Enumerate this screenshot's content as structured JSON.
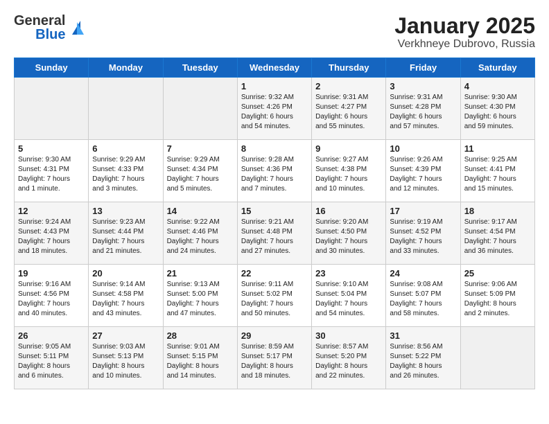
{
  "header": {
    "logo_general": "General",
    "logo_blue": "Blue",
    "title": "January 2025",
    "subtitle": "Verkhneye Dubrovo, Russia"
  },
  "days_of_week": [
    "Sunday",
    "Monday",
    "Tuesday",
    "Wednesday",
    "Thursday",
    "Friday",
    "Saturday"
  ],
  "weeks": [
    [
      {
        "day": "",
        "info": ""
      },
      {
        "day": "",
        "info": ""
      },
      {
        "day": "",
        "info": ""
      },
      {
        "day": "1",
        "info": "Sunrise: 9:32 AM\nSunset: 4:26 PM\nDaylight: 6 hours\nand 54 minutes."
      },
      {
        "day": "2",
        "info": "Sunrise: 9:31 AM\nSunset: 4:27 PM\nDaylight: 6 hours\nand 55 minutes."
      },
      {
        "day": "3",
        "info": "Sunrise: 9:31 AM\nSunset: 4:28 PM\nDaylight: 6 hours\nand 57 minutes."
      },
      {
        "day": "4",
        "info": "Sunrise: 9:30 AM\nSunset: 4:30 PM\nDaylight: 6 hours\nand 59 minutes."
      }
    ],
    [
      {
        "day": "5",
        "info": "Sunrise: 9:30 AM\nSunset: 4:31 PM\nDaylight: 7 hours\nand 1 minute."
      },
      {
        "day": "6",
        "info": "Sunrise: 9:29 AM\nSunset: 4:33 PM\nDaylight: 7 hours\nand 3 minutes."
      },
      {
        "day": "7",
        "info": "Sunrise: 9:29 AM\nSunset: 4:34 PM\nDaylight: 7 hours\nand 5 minutes."
      },
      {
        "day": "8",
        "info": "Sunrise: 9:28 AM\nSunset: 4:36 PM\nDaylight: 7 hours\nand 7 minutes."
      },
      {
        "day": "9",
        "info": "Sunrise: 9:27 AM\nSunset: 4:38 PM\nDaylight: 7 hours\nand 10 minutes."
      },
      {
        "day": "10",
        "info": "Sunrise: 9:26 AM\nSunset: 4:39 PM\nDaylight: 7 hours\nand 12 minutes."
      },
      {
        "day": "11",
        "info": "Sunrise: 9:25 AM\nSunset: 4:41 PM\nDaylight: 7 hours\nand 15 minutes."
      }
    ],
    [
      {
        "day": "12",
        "info": "Sunrise: 9:24 AM\nSunset: 4:43 PM\nDaylight: 7 hours\nand 18 minutes."
      },
      {
        "day": "13",
        "info": "Sunrise: 9:23 AM\nSunset: 4:44 PM\nDaylight: 7 hours\nand 21 minutes."
      },
      {
        "day": "14",
        "info": "Sunrise: 9:22 AM\nSunset: 4:46 PM\nDaylight: 7 hours\nand 24 minutes."
      },
      {
        "day": "15",
        "info": "Sunrise: 9:21 AM\nSunset: 4:48 PM\nDaylight: 7 hours\nand 27 minutes."
      },
      {
        "day": "16",
        "info": "Sunrise: 9:20 AM\nSunset: 4:50 PM\nDaylight: 7 hours\nand 30 minutes."
      },
      {
        "day": "17",
        "info": "Sunrise: 9:19 AM\nSunset: 4:52 PM\nDaylight: 7 hours\nand 33 minutes."
      },
      {
        "day": "18",
        "info": "Sunrise: 9:17 AM\nSunset: 4:54 PM\nDaylight: 7 hours\nand 36 minutes."
      }
    ],
    [
      {
        "day": "19",
        "info": "Sunrise: 9:16 AM\nSunset: 4:56 PM\nDaylight: 7 hours\nand 40 minutes."
      },
      {
        "day": "20",
        "info": "Sunrise: 9:14 AM\nSunset: 4:58 PM\nDaylight: 7 hours\nand 43 minutes."
      },
      {
        "day": "21",
        "info": "Sunrise: 9:13 AM\nSunset: 5:00 PM\nDaylight: 7 hours\nand 47 minutes."
      },
      {
        "day": "22",
        "info": "Sunrise: 9:11 AM\nSunset: 5:02 PM\nDaylight: 7 hours\nand 50 minutes."
      },
      {
        "day": "23",
        "info": "Sunrise: 9:10 AM\nSunset: 5:04 PM\nDaylight: 7 hours\nand 54 minutes."
      },
      {
        "day": "24",
        "info": "Sunrise: 9:08 AM\nSunset: 5:07 PM\nDaylight: 7 hours\nand 58 minutes."
      },
      {
        "day": "25",
        "info": "Sunrise: 9:06 AM\nSunset: 5:09 PM\nDaylight: 8 hours\nand 2 minutes."
      }
    ],
    [
      {
        "day": "26",
        "info": "Sunrise: 9:05 AM\nSunset: 5:11 PM\nDaylight: 8 hours\nand 6 minutes."
      },
      {
        "day": "27",
        "info": "Sunrise: 9:03 AM\nSunset: 5:13 PM\nDaylight: 8 hours\nand 10 minutes."
      },
      {
        "day": "28",
        "info": "Sunrise: 9:01 AM\nSunset: 5:15 PM\nDaylight: 8 hours\nand 14 minutes."
      },
      {
        "day": "29",
        "info": "Sunrise: 8:59 AM\nSunset: 5:17 PM\nDaylight: 8 hours\nand 18 minutes."
      },
      {
        "day": "30",
        "info": "Sunrise: 8:57 AM\nSunset: 5:20 PM\nDaylight: 8 hours\nand 22 minutes."
      },
      {
        "day": "31",
        "info": "Sunrise: 8:56 AM\nSunset: 5:22 PM\nDaylight: 8 hours\nand 26 minutes."
      },
      {
        "day": "",
        "info": ""
      }
    ]
  ]
}
